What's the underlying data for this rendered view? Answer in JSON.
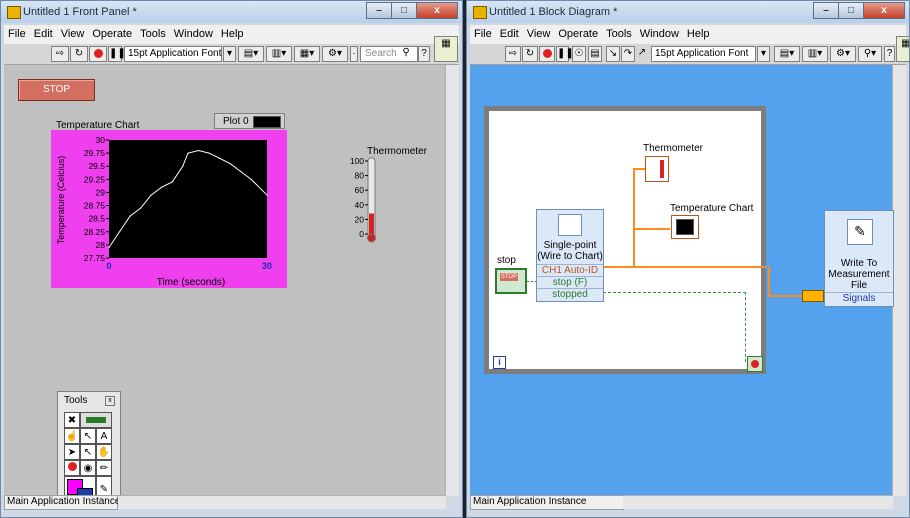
{
  "front_panel": {
    "title": "Untitled 1 Front Panel *",
    "menu": [
      "File",
      "Edit",
      "View",
      "Operate",
      "Tools",
      "Window",
      "Help"
    ],
    "font_selector": "15pt Application Font",
    "search_placeholder": "Search",
    "stop_button": "STOP",
    "chart": {
      "label": "Temperature Chart",
      "legend": "Plot 0",
      "xlabel": "Time (seconds)",
      "ylabel": "Temperature (Celcius)",
      "y_ticks": [
        "30",
        "29.75",
        "29.5",
        "29.25",
        "29",
        "28.75",
        "28.5",
        "28.25",
        "28",
        "27.75"
      ],
      "x_min_label": "0",
      "x_max_label": "30"
    },
    "thermometer": {
      "label": "Thermometer",
      "ticks": [
        "100",
        "80",
        "60",
        "40",
        "20",
        "0"
      ],
      "level_percent": 28
    },
    "tools_palette": {
      "title": "Tools"
    },
    "status": "Main Application Instance"
  },
  "block_diagram": {
    "title": "Untitled 1 Block Diagram *",
    "menu": [
      "File",
      "Edit",
      "View",
      "Operate",
      "Tools",
      "Window",
      "Help"
    ],
    "font_selector": "15pt Application Font",
    "thermometer_label": "Thermometer",
    "chart_label": "Temperature Chart",
    "stop_label": "stop",
    "stop_terminal": "STOP",
    "express_vi": {
      "title_line1": "Single-point",
      "title_line2": "(Wire to Chart)",
      "row1": "CH1 Auto-ID",
      "row2": "stop (F)",
      "row3": "stopped"
    },
    "write_vi": {
      "line1": "Write To",
      "line2": "Measurement",
      "line3": "File",
      "row": "Signals"
    },
    "loop_index": "i",
    "status": "Main Application Instance"
  },
  "chart_data": {
    "type": "line",
    "title": "",
    "xlabel": "Time (seconds)",
    "ylabel": "Temperature (Celcius)",
    "xlim": [
      0,
      30
    ],
    "ylim": [
      27.75,
      30
    ],
    "series": [
      {
        "name": "Plot 0",
        "x": [
          0,
          2,
          4,
          6,
          8,
          10,
          12,
          14,
          15,
          17,
          19,
          21,
          23,
          25,
          27,
          29,
          30
        ],
        "y": [
          27.95,
          28.25,
          28.55,
          28.7,
          28.95,
          29.1,
          29.2,
          29.5,
          29.75,
          29.8,
          29.75,
          29.65,
          29.55,
          29.4,
          29.25,
          29.05,
          28.95
        ]
      }
    ],
    "colors": {
      "background": "#000000",
      "frame": "#ef3fef",
      "line": "#ffffff"
    }
  }
}
